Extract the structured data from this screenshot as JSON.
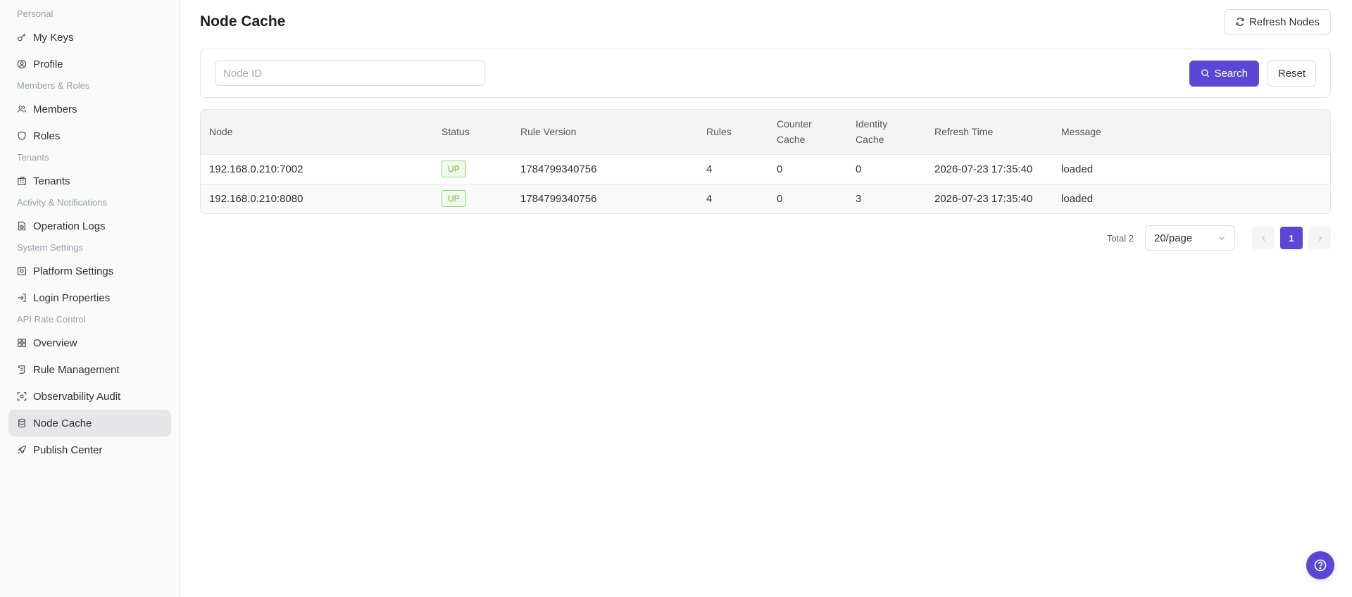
{
  "sidebar": {
    "groups": [
      {
        "title": "Personal",
        "items": [
          {
            "label": "My Keys",
            "icon": "key-icon"
          },
          {
            "label": "Profile",
            "icon": "user-circle-icon"
          }
        ]
      },
      {
        "title": "Members & Roles",
        "items": [
          {
            "label": "Members",
            "icon": "users-icon"
          },
          {
            "label": "Roles",
            "icon": "shield-icon"
          }
        ]
      },
      {
        "title": "Tenants",
        "items": [
          {
            "label": "Tenants",
            "icon": "building-icon"
          }
        ]
      },
      {
        "title": "Activity & Notifications",
        "items": [
          {
            "label": "Operation Logs",
            "icon": "log-icon"
          }
        ]
      },
      {
        "title": "System Settings",
        "items": [
          {
            "label": "Platform Settings",
            "icon": "settings-icon"
          },
          {
            "label": "Login Properties",
            "icon": "login-icon"
          }
        ]
      },
      {
        "title": "API Rate Control",
        "items": [
          {
            "label": "Overview",
            "icon": "grid-icon"
          },
          {
            "label": "Rule Management",
            "icon": "scroll-icon"
          },
          {
            "label": "Observability Audit",
            "icon": "eye-scan-icon"
          },
          {
            "label": "Node Cache",
            "icon": "database-icon"
          },
          {
            "label": "Publish Center",
            "icon": "rocket-icon"
          }
        ]
      }
    ],
    "active_item": "Node Cache"
  },
  "header": {
    "title": "Node Cache",
    "refresh_label": "Refresh Nodes"
  },
  "search": {
    "placeholder": "Node ID",
    "value": "",
    "search_label": "Search",
    "reset_label": "Reset"
  },
  "table": {
    "columns": {
      "node": "Node",
      "status": "Status",
      "rule_version": "Rule Version",
      "rules": "Rules",
      "counter_cache_1": "Counter",
      "counter_cache_2": "Cache",
      "identity_cache_1": "Identity",
      "identity_cache_2": "Cache",
      "refresh_time": "Refresh Time",
      "message": "Message"
    },
    "rows": [
      {
        "node": "192.168.0.210:7002",
        "status": "UP",
        "rule_version": "1784799340756",
        "rules": "4",
        "counter_cache": "0",
        "identity_cache": "0",
        "refresh_time": "2026-07-23 17:35:40",
        "message": "loaded"
      },
      {
        "node": "192.168.0.210:8080",
        "status": "UP",
        "rule_version": "1784799340756",
        "rules": "4",
        "counter_cache": "0",
        "identity_cache": "3",
        "refresh_time": "2026-07-23 17:35:40",
        "message": "loaded"
      }
    ]
  },
  "pagination": {
    "total_label": "Total 2",
    "page_size": "20/page",
    "current_page": "1"
  },
  "colors": {
    "primary": "#5b47d6",
    "status_up": "#67c23a"
  }
}
